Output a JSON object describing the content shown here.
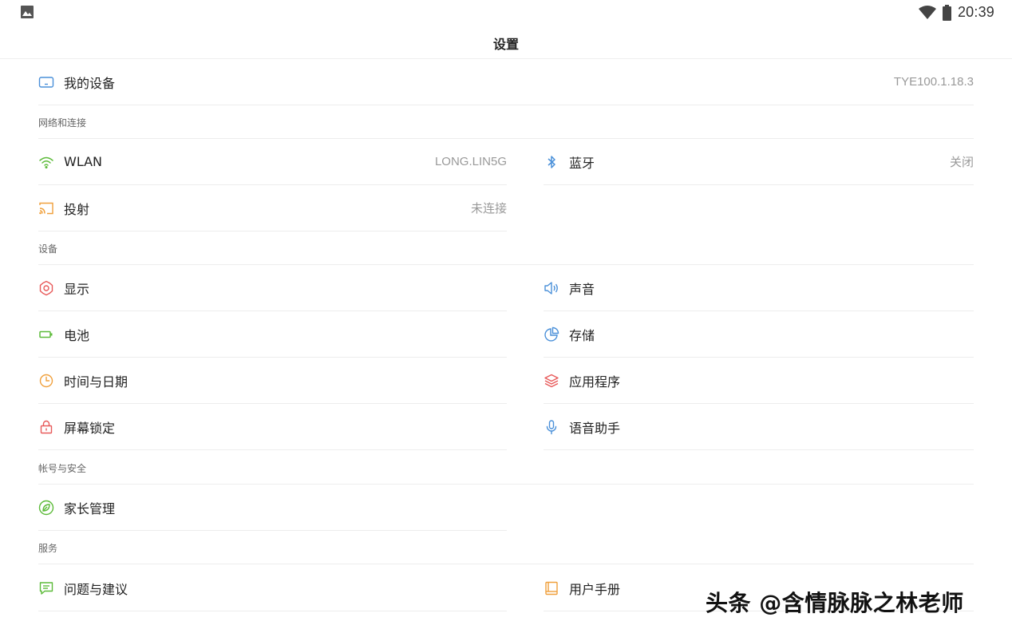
{
  "status_bar": {
    "time": "20:39",
    "icons": [
      "gallery-icon",
      "wifi-icon",
      "battery-icon"
    ]
  },
  "title": "设置",
  "my_device": {
    "label": "我的设备",
    "value": "TYE100.1.18.3",
    "icon": "device-icon"
  },
  "sections": {
    "network": "网络和连接",
    "device": "设备",
    "account": "帐号与安全",
    "service": "服务"
  },
  "items": {
    "wlan": {
      "label": "WLAN",
      "value": "LONG.LIN5G",
      "icon": "wifi-icon"
    },
    "bluetooth": {
      "label": "蓝牙",
      "value": "关闭",
      "icon": "bluetooth-icon"
    },
    "cast": {
      "label": "投射",
      "value": "未连接",
      "icon": "cast-icon"
    },
    "display": {
      "label": "显示",
      "icon": "gear-icon"
    },
    "sound": {
      "label": "声音",
      "icon": "speaker-icon"
    },
    "battery": {
      "label": "电池",
      "icon": "battery-icon"
    },
    "storage": {
      "label": "存储",
      "icon": "pie-icon"
    },
    "datetime": {
      "label": "时间与日期",
      "icon": "clock-icon"
    },
    "apps": {
      "label": "应用程序",
      "icon": "layers-icon"
    },
    "lock": {
      "label": "屏幕锁定",
      "icon": "lock-icon"
    },
    "voice": {
      "label": "语音助手",
      "icon": "mic-icon"
    },
    "parental": {
      "label": "家长管理",
      "icon": "leaf-icon"
    },
    "feedback": {
      "label": "问题与建议",
      "icon": "chat-icon"
    },
    "manual": {
      "label": "用户手册",
      "icon": "book-icon"
    }
  },
  "watermark": "头条 @含情脉脉之林老师",
  "colors": {
    "blue": "#4a90d9",
    "green": "#5dbb3a",
    "orange": "#f0a03c",
    "red": "#e85a5a"
  }
}
